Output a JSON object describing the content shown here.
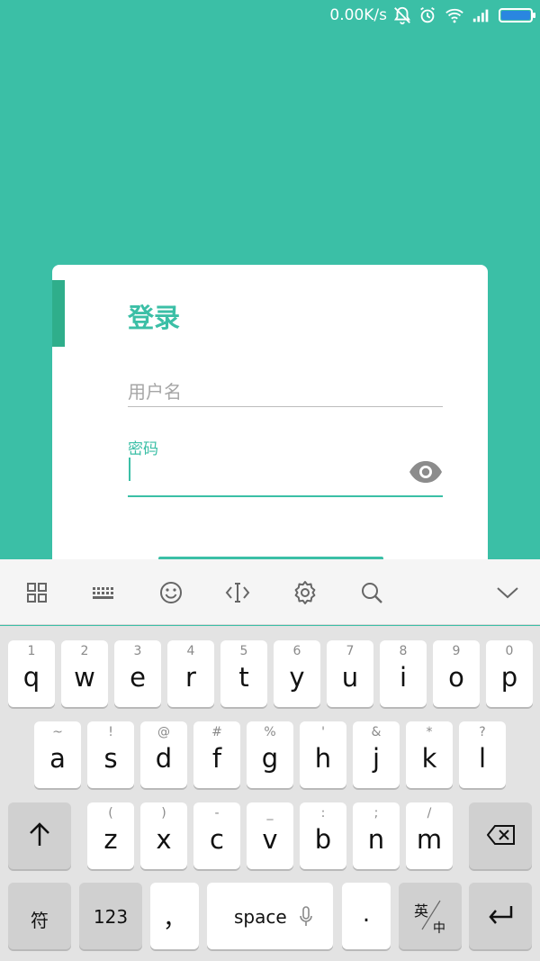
{
  "status_bar": {
    "net_speed": "0.00K/s"
  },
  "login": {
    "title": "登录",
    "username_placeholder": "用户名",
    "password_label": "密码"
  },
  "keyboard": {
    "row1": [
      {
        "hint": "1",
        "key": "q"
      },
      {
        "hint": "2",
        "key": "w"
      },
      {
        "hint": "3",
        "key": "e"
      },
      {
        "hint": "4",
        "key": "r"
      },
      {
        "hint": "5",
        "key": "t"
      },
      {
        "hint": "6",
        "key": "y"
      },
      {
        "hint": "7",
        "key": "u"
      },
      {
        "hint": "8",
        "key": "i"
      },
      {
        "hint": "9",
        "key": "o"
      },
      {
        "hint": "0",
        "key": "p"
      }
    ],
    "row2": [
      {
        "hint": "~",
        "key": "a"
      },
      {
        "hint": "!",
        "key": "s"
      },
      {
        "hint": "@",
        "key": "d"
      },
      {
        "hint": "#",
        "key": "f"
      },
      {
        "hint": "%",
        "key": "g"
      },
      {
        "hint": "'",
        "key": "h"
      },
      {
        "hint": "&",
        "key": "j"
      },
      {
        "hint": "*",
        "key": "k"
      },
      {
        "hint": "?",
        "key": "l"
      }
    ],
    "row3": [
      {
        "hint": "(",
        "key": "z"
      },
      {
        "hint": ")",
        "key": "x"
      },
      {
        "hint": "-",
        "key": "c"
      },
      {
        "hint": "_",
        "key": "v"
      },
      {
        "hint": ":",
        "key": "b"
      },
      {
        "hint": ";",
        "key": "n"
      },
      {
        "hint": "/",
        "key": "m"
      }
    ],
    "symbol_label": "符",
    "numbers_label": "123",
    "comma_label": "，",
    "space_label": "space",
    "period_label": ".",
    "lang_en": "英",
    "lang_zh": "中"
  }
}
